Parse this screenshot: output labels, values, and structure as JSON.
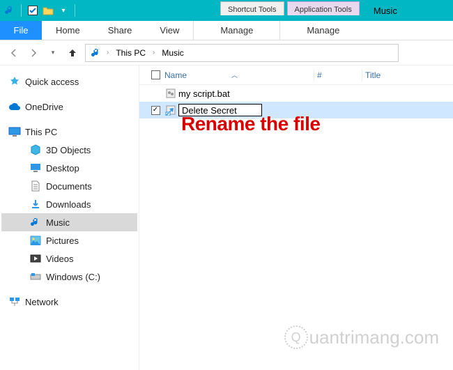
{
  "titlebar": {
    "ctx_tab1": "Shortcut Tools",
    "ctx_tab2": "Application Tools",
    "window_title": "Music"
  },
  "tabs": {
    "file": "File",
    "home": "Home",
    "share": "Share",
    "view": "View",
    "manage1": "Manage",
    "manage2": "Manage"
  },
  "breadcrumb": {
    "item1": "This PC",
    "item2": "Music"
  },
  "sidebar": {
    "quick_access": "Quick access",
    "onedrive": "OneDrive",
    "this_pc": "This PC",
    "objects3d": "3D Objects",
    "desktop": "Desktop",
    "documents": "Documents",
    "downloads": "Downloads",
    "music": "Music",
    "pictures": "Pictures",
    "videos": "Videos",
    "windows_c": "Windows (C:)",
    "network": "Network"
  },
  "columns": {
    "name": "Name",
    "num": "#",
    "title": "Title"
  },
  "files": {
    "row1": "my script.bat",
    "row2_editing": "Delete Secret"
  },
  "annotation": "Rename the file",
  "watermark": "uantrimang.com",
  "watermark_globe": "Q"
}
